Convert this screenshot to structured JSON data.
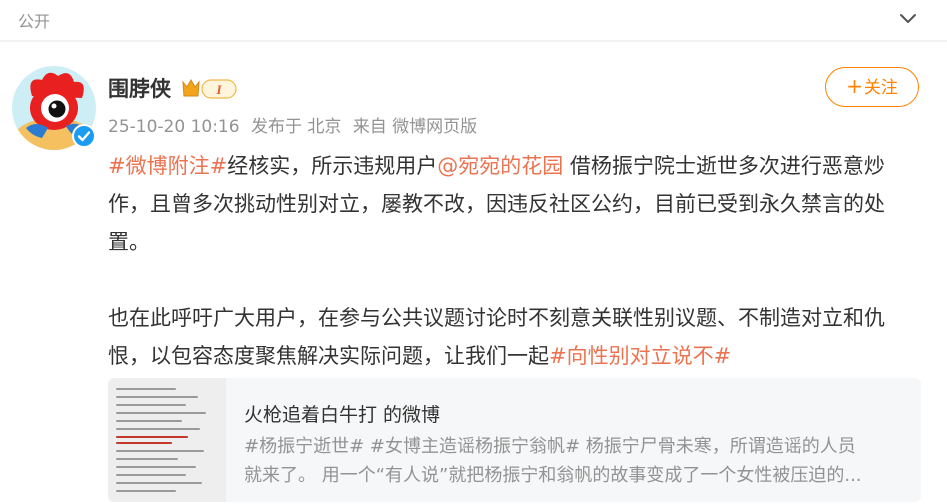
{
  "topbar": {
    "visibility_label": "公开",
    "collapse_icon": "chevron-down-icon"
  },
  "post": {
    "username": "围脖侠",
    "badge_text": "I",
    "timestamp": "25-10-20 10:16",
    "location": "发布于 北京",
    "source": "来自 微博网页版",
    "follow_label": "关注",
    "paragraph1": {
      "hashtag": "#微博附注#",
      "text_a": "经核实，所示违规用户",
      "mention": "@宛宛的花园",
      "text_b": " 借杨振宁院士逝世多次进行恶意炒作，且曾多次挑动性别对立，屡教不改，因违反社区公约，目前已受到永久禁言的处置。"
    },
    "paragraph2": {
      "text": "也在此呼吁广大用户，在参与公共议题讨论时不刻意关联性别议题、不制造对立和仇恨，以包容态度聚焦解决实际问题，让我们一起",
      "hashtag": "#向性别对立说不#"
    }
  },
  "repost_card": {
    "title": "火枪追着白牛打 的微博",
    "line1": "#杨振宁逝世# #女博主造谣杨振宁翁帆# 杨振宁尸骨未寒，所谓造谣的人员",
    "line2": "就来了。 用一个“有人说”就把杨振宁和翁帆的故事变成了一个女性被压迫的..."
  },
  "colors": {
    "accent": "#ff8200",
    "link": "#eb7350",
    "muted": "#939393",
    "verified": "#1a9cf3"
  }
}
